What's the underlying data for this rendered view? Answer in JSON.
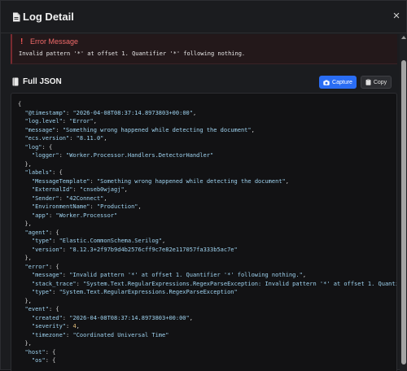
{
  "window": {
    "title": "Log Detail",
    "close_glyph": "×"
  },
  "error": {
    "icon": "!",
    "title": "Error Message",
    "message": "Invalid pattern '*' at offset 1. Quantifier '*' following nothing."
  },
  "json_section": {
    "title": "Full JSON",
    "capture_label": "Capture",
    "copy_label": "Copy"
  },
  "colors": {
    "accent": "#2a6df4",
    "error": "#f06a6a",
    "json_string": "#9fd3f0",
    "json_number": "#e7c07b"
  },
  "json_lines": [
    [
      [
        "p",
        "{"
      ]
    ],
    [
      [
        "p",
        "  "
      ],
      [
        "k",
        "\"@timestamp\""
      ],
      [
        "p",
        ": "
      ],
      [
        "s",
        "\"2026-04-08T08:37:14.8973803+00:00\""
      ],
      [
        "p",
        ","
      ]
    ],
    [
      [
        "p",
        "  "
      ],
      [
        "k",
        "\"log.level\""
      ],
      [
        "p",
        ": "
      ],
      [
        "s",
        "\"Error\""
      ],
      [
        "p",
        ","
      ]
    ],
    [
      [
        "p",
        "  "
      ],
      [
        "k",
        "\"message\""
      ],
      [
        "p",
        ": "
      ],
      [
        "s",
        "\"Something wrong happened while detecting the document\""
      ],
      [
        "p",
        ","
      ]
    ],
    [
      [
        "p",
        "  "
      ],
      [
        "k",
        "\"ecs.version\""
      ],
      [
        "p",
        ": "
      ],
      [
        "s",
        "\"8.11.0\""
      ],
      [
        "p",
        ","
      ]
    ],
    [
      [
        "p",
        "  "
      ],
      [
        "k",
        "\"log\""
      ],
      [
        "p",
        ": {"
      ]
    ],
    [
      [
        "p",
        "    "
      ],
      [
        "k",
        "\"logger\""
      ],
      [
        "p",
        ": "
      ],
      [
        "s",
        "\"Worker.Processor.Handlers.DetectorHandler\""
      ]
    ],
    [
      [
        "p",
        "  },"
      ]
    ],
    [
      [
        "p",
        "  "
      ],
      [
        "k",
        "\"labels\""
      ],
      [
        "p",
        ": {"
      ]
    ],
    [
      [
        "p",
        "    "
      ],
      [
        "k",
        "\"MessageTemplate\""
      ],
      [
        "p",
        ": "
      ],
      [
        "s",
        "\"Something wrong happened while detecting the document\""
      ],
      [
        "p",
        ","
      ]
    ],
    [
      [
        "p",
        "    "
      ],
      [
        "k",
        "\"ExternalId\""
      ],
      [
        "p",
        ": "
      ],
      [
        "s",
        "\"cnseb0wjagj\""
      ],
      [
        "p",
        ","
      ]
    ],
    [
      [
        "p",
        "    "
      ],
      [
        "k",
        "\"Sender\""
      ],
      [
        "p",
        ": "
      ],
      [
        "s",
        "\"42Connect\""
      ],
      [
        "p",
        ","
      ]
    ],
    [
      [
        "p",
        "    "
      ],
      [
        "k",
        "\"EnvironmentName\""
      ],
      [
        "p",
        ": "
      ],
      [
        "s",
        "\"Production\""
      ],
      [
        "p",
        ","
      ]
    ],
    [
      [
        "p",
        "    "
      ],
      [
        "k",
        "\"app\""
      ],
      [
        "p",
        ": "
      ],
      [
        "s",
        "\"Worker.Processor\""
      ]
    ],
    [
      [
        "p",
        "  },"
      ]
    ],
    [
      [
        "p",
        "  "
      ],
      [
        "k",
        "\"agent\""
      ],
      [
        "p",
        ": {"
      ]
    ],
    [
      [
        "p",
        "    "
      ],
      [
        "k",
        "\"type\""
      ],
      [
        "p",
        ": "
      ],
      [
        "s",
        "\"Elastic.CommonSchema.Serilog\""
      ],
      [
        "p",
        ","
      ]
    ],
    [
      [
        "p",
        "    "
      ],
      [
        "k",
        "\"version\""
      ],
      [
        "p",
        ": "
      ],
      [
        "s",
        "\"8.12.3+2f97b9d4b2576cff9c7e82e117057fa333b5ac7e\""
      ]
    ],
    [
      [
        "p",
        "  },"
      ]
    ],
    [
      [
        "p",
        "  "
      ],
      [
        "k",
        "\"error\""
      ],
      [
        "p",
        ": {"
      ]
    ],
    [
      [
        "p",
        "    "
      ],
      [
        "k",
        "\"message\""
      ],
      [
        "p",
        ": "
      ],
      [
        "s",
        "\"Invalid pattern '*' at offset 1. Quantifier '*' following nothing.\""
      ],
      [
        "p",
        ","
      ]
    ],
    [
      [
        "p",
        "    "
      ],
      [
        "k",
        "\"stack_trace\""
      ],
      [
        "p",
        ": "
      ],
      [
        "s",
        "\"System.Text.RegularExpressions.RegexParseException: Invalid pattern '*' at offset 1. Quantifier"
      ]
    ],
    [
      [
        "p",
        "    "
      ],
      [
        "k",
        "\"type\""
      ],
      [
        "p",
        ": "
      ],
      [
        "s",
        "\"System.Text.RegularExpressions.RegexParseException\""
      ]
    ],
    [
      [
        "p",
        "  },"
      ]
    ],
    [
      [
        "p",
        "  "
      ],
      [
        "k",
        "\"event\""
      ],
      [
        "p",
        ": {"
      ]
    ],
    [
      [
        "p",
        "    "
      ],
      [
        "k",
        "\"created\""
      ],
      [
        "p",
        ": "
      ],
      [
        "s",
        "\"2026-04-08T08:37:14.8973803+00:00\""
      ],
      [
        "p",
        ","
      ]
    ],
    [
      [
        "p",
        "    "
      ],
      [
        "k",
        "\"severity\""
      ],
      [
        "p",
        ": "
      ],
      [
        "n",
        "4"
      ],
      [
        "p",
        ","
      ]
    ],
    [
      [
        "p",
        "    "
      ],
      [
        "k",
        "\"timezone\""
      ],
      [
        "p",
        ": "
      ],
      [
        "s",
        "\"Coordinated Universal Time\""
      ]
    ],
    [
      [
        "p",
        "  },"
      ]
    ],
    [
      [
        "p",
        "  "
      ],
      [
        "k",
        "\"host\""
      ],
      [
        "p",
        ": {"
      ]
    ],
    [
      [
        "p",
        "    "
      ],
      [
        "k",
        "\"os\""
      ],
      [
        "p",
        ": {"
      ]
    ]
  ]
}
